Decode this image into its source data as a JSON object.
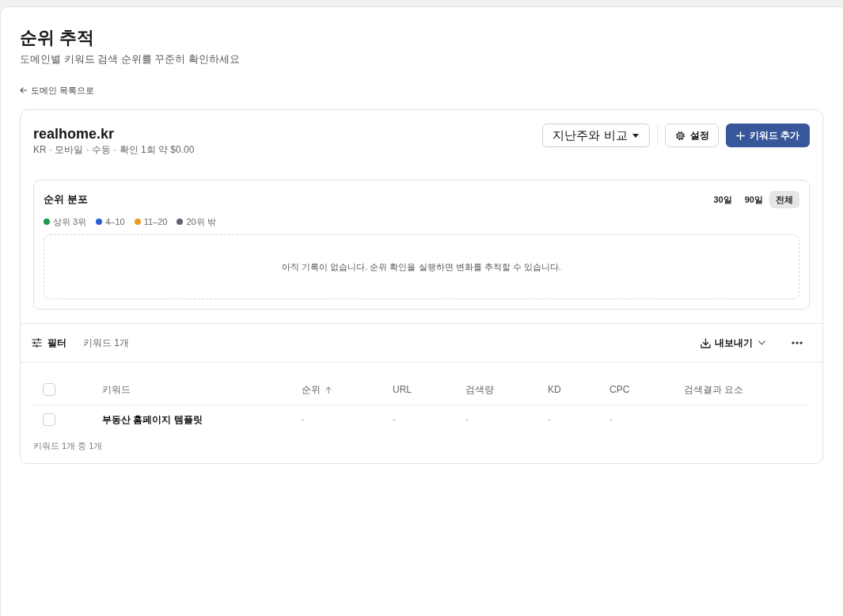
{
  "header": {
    "title": "순위 추적",
    "subtitle": "도메인별 키워드 검색 순위를 꾸준히 확인하세요",
    "back_link": "도메인 목록으로"
  },
  "domain": {
    "name": "realhome.kr",
    "meta": "KR · 모바일 · 수동 · 확인 1회 약 $0.00",
    "compare_label": "지난주와 비교",
    "settings_label": "설정",
    "add_label": "키워드 추가"
  },
  "distribution": {
    "title": "순위 분포",
    "ranges": [
      {
        "label": "30일",
        "selected": false
      },
      {
        "label": "90일",
        "selected": false
      },
      {
        "label": "전체",
        "selected": true
      }
    ],
    "legend": [
      {
        "label": "상위 3위",
        "color": "#1e9a4c"
      },
      {
        "label": "4–10",
        "color": "#2c5fd8"
      },
      {
        "label": "11–20",
        "color": "#f09a24"
      },
      {
        "label": "20위 밖",
        "color": "#5e6570"
      }
    ],
    "empty_message": "아직 기록이 없습니다. 순위 확인을 실행하면 변화를 추적할 수 있습니다."
  },
  "toolbar": {
    "filter_label": "필터",
    "count": "키워드 1개",
    "export_label": "내보내기"
  },
  "table": {
    "select_all_checked": false,
    "columns": [
      {
        "label": "키워드"
      },
      {
        "label": "순위",
        "sort_ascending": true
      },
      {
        "label": "URL"
      },
      {
        "label": "검색량"
      },
      {
        "label": "KD"
      },
      {
        "label": "CPC"
      },
      {
        "label": "검색결과 요소"
      }
    ],
    "rows": [
      {
        "checked": false,
        "cells": [
          "부동산 홈페이지 템플릿",
          "-",
          "-",
          "-",
          "-",
          "-"
        ]
      }
    ]
  },
  "footer": "키워드 1개 중 1개"
}
